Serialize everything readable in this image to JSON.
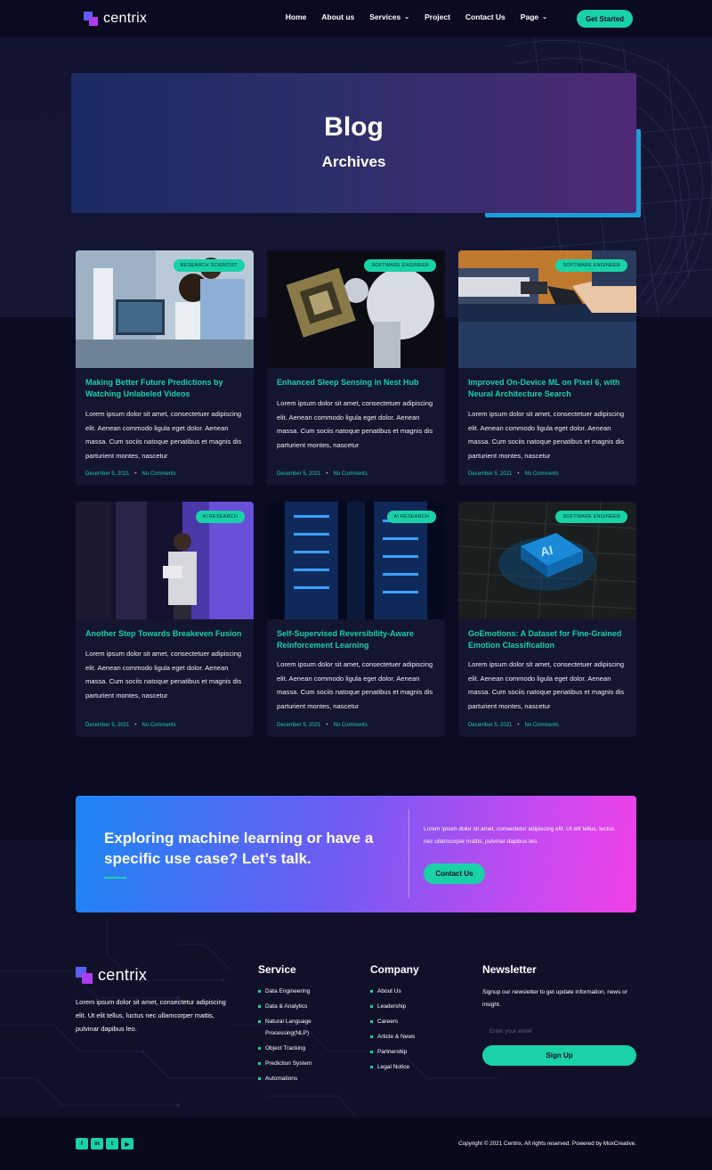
{
  "nav": {
    "brand": "centrix",
    "items": [
      {
        "label": "Home",
        "dropdown": false
      },
      {
        "label": "About us",
        "dropdown": false
      },
      {
        "label": "Services",
        "dropdown": true
      },
      {
        "label": "Project",
        "dropdown": false
      },
      {
        "label": "Contact Us",
        "dropdown": false
      },
      {
        "label": "Page",
        "dropdown": true
      }
    ],
    "cta": "Get Started"
  },
  "hero": {
    "title": "Blog",
    "subtitle": "Archives"
  },
  "posts": [
    {
      "badge": "Research Scientist",
      "title": "Making Better Future Predictions by Watching Unlabeled Videos",
      "excerpt": "Lorem ipsum dolor sit amet, consectetuer adipiscing elit. Aenean commodo ligula eget dolor. Aenean massa. Cum sociis natoque penatibus et magnis dis parturient montes, nascetur",
      "date": "December 5, 2021",
      "comments": "No Comments"
    },
    {
      "badge": "Software Engineer",
      "title": "Enhanced Sleep Sensing in Nest Hub",
      "excerpt": "Lorem ipsum dolor sit amet, consectetuer adipiscing elit. Aenean commodo ligula eget dolor. Aenean massa. Cum sociis natoque penatibus et magnis dis parturient montes, nascetur",
      "date": "December 5, 2021",
      "comments": "No Comments"
    },
    {
      "badge": "Software Engineer",
      "title": "Improved On-Device ML on Pixel 6, with Neural Architecture Search",
      "excerpt": "Lorem ipsum dolor sit amet, consectetuer adipiscing elit. Aenean commodo ligula eget dolor. Aenean massa. Cum sociis natoque penatibus et magnis dis parturient montes, nascetur",
      "date": "December 5, 2021",
      "comments": "No Comments"
    },
    {
      "badge": "AI Research",
      "title": "Another Step Towards Breakeven Fusion",
      "excerpt": "Lorem ipsum dolor sit amet, consectetuer adipiscing elit. Aenean commodo ligula eget dolor. Aenean massa. Cum sociis natoque penatibus et magnis dis parturient montes, nascetur",
      "date": "December 5, 2021",
      "comments": "No Comments"
    },
    {
      "badge": "AI Research",
      "title": "Self-Supervised Reversibility-Aware Reinforcement Learning",
      "excerpt": "Lorem ipsum dolor sit amet, consectetuer adipiscing elit. Aenean commodo ligula eget dolor. Aenean massa. Cum sociis natoque penatibus et magnis dis parturient montes, nascetur",
      "date": "December 5, 2021",
      "comments": "No Comments"
    },
    {
      "badge": "Software Engineer",
      "title": "GoEmotions: A Dataset for Fine-Grained Emotion Classification",
      "excerpt": "Lorem ipsum dolor sit amet, consectetuer adipiscing elit. Aenean commodo ligula eget dolor. Aenean massa. Cum sociis natoque penatibus et magnis dis parturient montes, nascetur",
      "date": "December 5, 2021",
      "comments": "No Comments"
    }
  ],
  "cta": {
    "title": "Exploring machine learning or have a specific use case? Let’s talk.",
    "text": "Lorem ipsum dolor sit amet, consectetur adipiscing elit. Ut elit tellus, luctus nec ullamcorper mattis, pulvinar dapibus leo.",
    "button": "Contact Us"
  },
  "footer": {
    "brand": "centrix",
    "about": "Lorem ipsum dolor sit amet, consectetur adipiscing elit. Ut elit tellus, luctus nec ullamcorper mattis, pulvinar dapibus leo.",
    "service": {
      "title": "Service",
      "items": [
        "Data Engineering",
        "Data & Analytics",
        "Natural Language Processing(NLP)",
        "Object Tracking",
        "Prediction System",
        "Automations"
      ]
    },
    "company": {
      "title": "Company",
      "items": [
        "About Us",
        "Leadership",
        "Careers",
        "Article & News",
        "Partnership",
        "Legal Notice"
      ]
    },
    "newsletter": {
      "title": "Newsletter",
      "text": "Signup our newsletter to get update information, news or insight.",
      "placeholder": "Enter your email",
      "button": "Sign Up"
    },
    "socials": [
      "f",
      "in",
      "t",
      "▶"
    ],
    "social_icons": [
      "facebook-icon",
      "linkedin-icon",
      "twitter-icon",
      "youtube-icon"
    ],
    "copyright": "Copyright © 2021 Centrix, All rights reserved. Powered by MoxCreative."
  },
  "colors": {
    "accent": "#19d2a7",
    "background": "#0b0c22",
    "card": "#14152e",
    "cta_start": "#1b86f5",
    "cta_end": "#f240e8"
  }
}
